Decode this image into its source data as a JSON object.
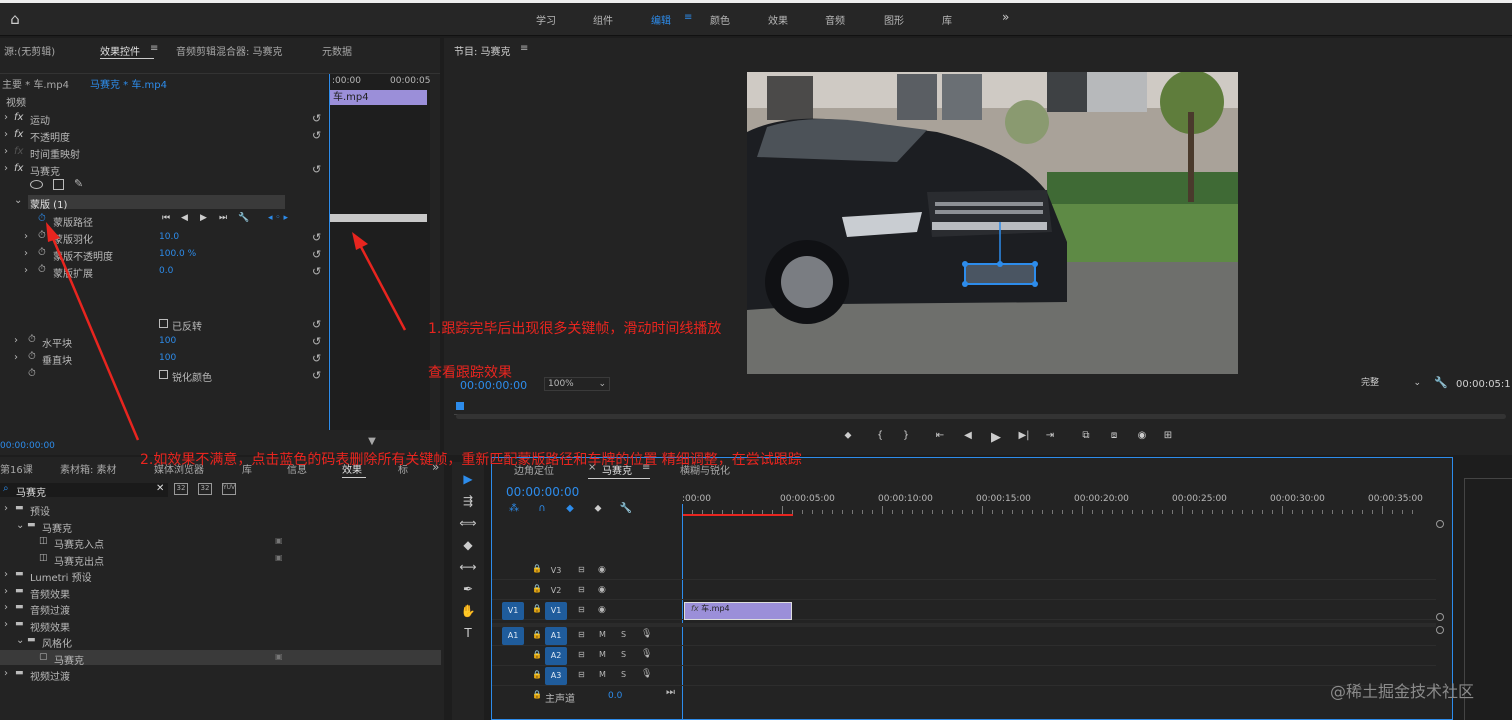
{
  "topnav": {
    "items": [
      "学习",
      "组件",
      "编辑",
      "颜色",
      "效果",
      "音频",
      "图形",
      "库"
    ],
    "active": "编辑",
    "more": "»"
  },
  "source_panel": {
    "tabs": [
      "源:(无剪辑)",
      "效果控件",
      "音频剪辑混合器: 马赛克",
      "元数据"
    ],
    "master": "主要 * 车.mp4",
    "clip": "马赛克 * 车.mp4",
    "time_start": ":00:00",
    "time_end": "00:00:05",
    "clip_bar": "车.mp4",
    "section": "视频",
    "effects": [
      {
        "name": "运动",
        "fx": "fx"
      },
      {
        "name": "不透明度",
        "fx": "fx"
      },
      {
        "name": "时间重映射",
        "fx": "fx"
      },
      {
        "name": "马赛克",
        "fx": "fx"
      }
    ],
    "mask": "蒙版 (1)",
    "mask_props": [
      {
        "name": "蒙版路径",
        "value": ""
      },
      {
        "name": "蒙版羽化",
        "value": "10.0"
      },
      {
        "name": "蒙版不透明度",
        "value": "100.0 %"
      },
      {
        "name": "蒙版扩展",
        "value": "0.0"
      }
    ],
    "inverted": "已反转",
    "blocks": [
      {
        "name": "水平块",
        "value": "100"
      },
      {
        "name": "垂直块",
        "value": "100"
      }
    ],
    "sharpen": "锐化颜色",
    "timecode": "00:00:00:00"
  },
  "program_panel": {
    "title": "节目: 马赛克",
    "timecode": "00:00:00:00",
    "zoom": "100%",
    "quality": "完整",
    "duration": "00:00:05:1"
  },
  "effects_panel": {
    "tabs": [
      "第16课",
      "素材箱: 素材",
      "媒体浏览器",
      "库",
      "信息",
      "效果",
      "标"
    ],
    "search": "马赛克",
    "tree": [
      {
        "label": "预设",
        "depth": 0,
        "type": "folder"
      },
      {
        "label": "马赛克",
        "depth": 1,
        "type": "folder"
      },
      {
        "label": "马赛克入点",
        "depth": 2,
        "type": "preset"
      },
      {
        "label": "马赛克出点",
        "depth": 2,
        "type": "preset"
      },
      {
        "label": "Lumetri 预设",
        "depth": 0,
        "type": "folder"
      },
      {
        "label": "音频效果",
        "depth": 0,
        "type": "folder"
      },
      {
        "label": "音频过渡",
        "depth": 0,
        "type": "folder"
      },
      {
        "label": "视频效果",
        "depth": 0,
        "type": "folder"
      },
      {
        "label": "风格化",
        "depth": 1,
        "type": "folder"
      },
      {
        "label": "马赛克",
        "depth": 2,
        "type": "effect"
      },
      {
        "label": "视频过渡",
        "depth": 0,
        "type": "folder"
      }
    ]
  },
  "timeline": {
    "tabs": [
      "边角定位",
      "马赛克",
      "横糊与锐化"
    ],
    "timecode": "00:00:00:00",
    "ruler": [
      ":00:00",
      "00:00:05:00",
      "00:00:10:00",
      "00:00:15:00",
      "00:00:20:00",
      "00:00:25:00",
      "00:00:30:00",
      "00:00:35:00"
    ],
    "video_tracks": [
      "V3",
      "V2",
      "V1"
    ],
    "audio_tracks": [
      "A1",
      "A2",
      "A3"
    ],
    "src_v": "V1",
    "src_a": "A1",
    "clip": "车.mp4",
    "fx": "fx",
    "master": "主声道",
    "master_val": "0.0",
    "M": "M",
    "S": "S"
  },
  "annotations": {
    "note1a": "1.跟踪完毕后出现很多关键帧，滑动时间线播放",
    "note1b": "查看跟踪效果",
    "note2": "2.如效果不满意，点击蓝色的码表删除所有关键帧，重新匹配蒙版路径和车牌的位置 精细调整，在尝试跟踪"
  },
  "watermark": "@稀土掘金技术社区",
  "colors": {
    "accent": "#2d8ceb",
    "clip": "#9b8fd9",
    "annotation": "#e8251f",
    "panel": "#232323"
  }
}
